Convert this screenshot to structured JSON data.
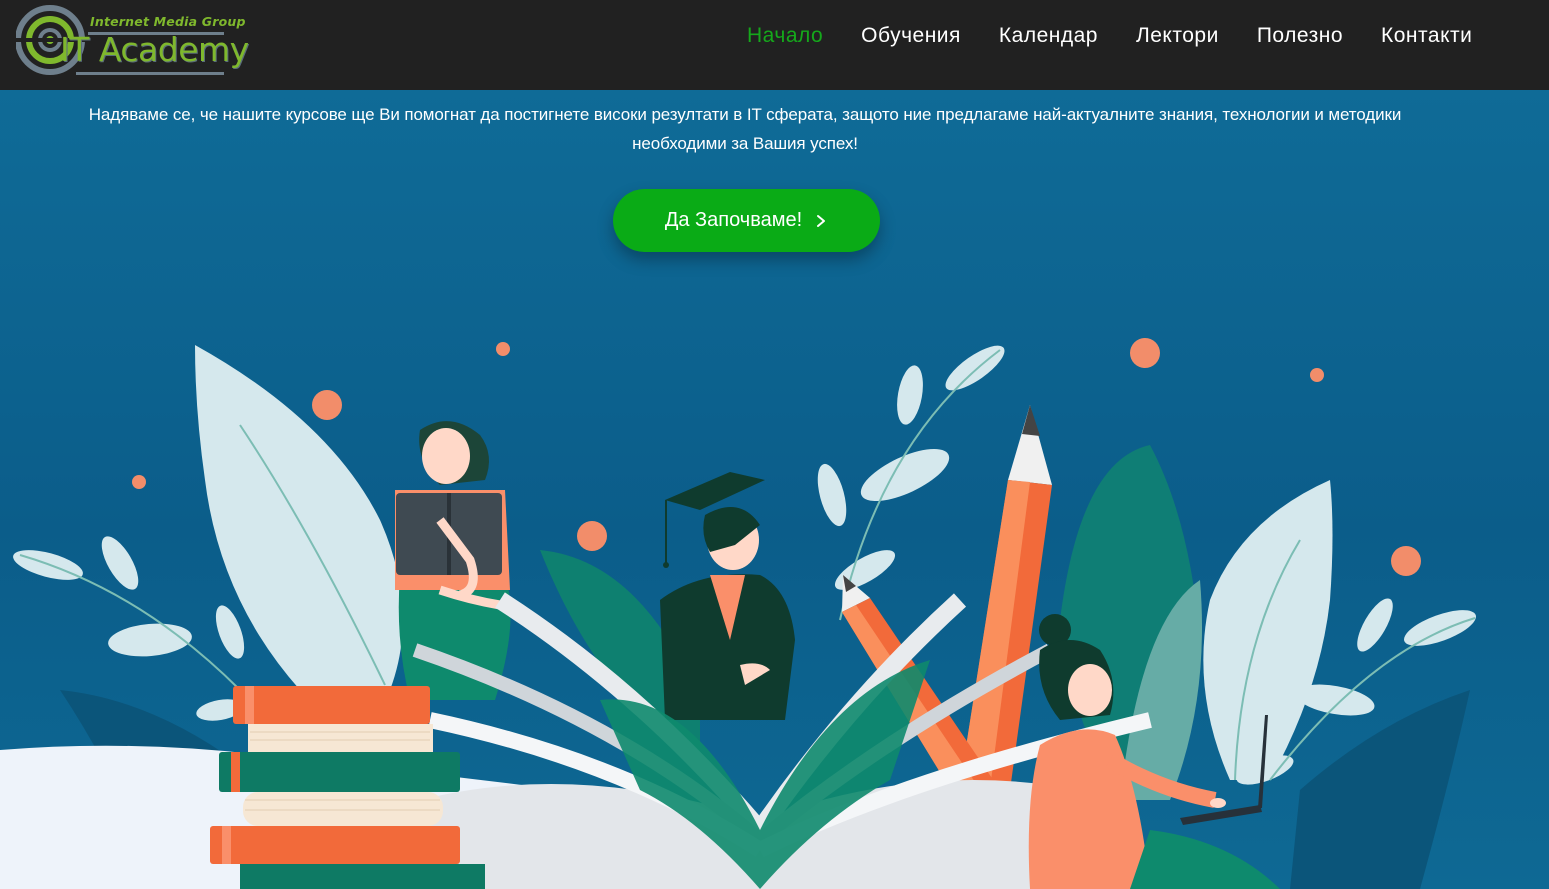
{
  "nav": {
    "logo": {
      "tagline": "Internet Media Group",
      "name": "IT Academy",
      "icon": "it-academy-logo"
    },
    "items": [
      {
        "label": "Начало",
        "active": true
      },
      {
        "label": "Обучения",
        "active": false
      },
      {
        "label": "Календар",
        "active": false
      },
      {
        "label": "Лектори",
        "active": false
      },
      {
        "label": "Полезно",
        "active": false
      },
      {
        "label": "Контакти",
        "active": false
      }
    ]
  },
  "hero": {
    "text": "Надяваме се, че нашите курсове ще Ви помогнат да постигнете високи резултати в IT сферата, защото ние предлагаме най-актуалните знания, технологии и методики необходими за Вашия успех!",
    "cta_label": "Да Започваме!",
    "cta_icon": "chevron-right-icon",
    "illustration": "education-illustration"
  },
  "colors": {
    "navbar_bg": "#212121",
    "active_nav": "#15a81b",
    "hero_bg": "#0d5f8c",
    "cta_bg": "#0aab16",
    "logo_green": "#7fb82d"
  }
}
